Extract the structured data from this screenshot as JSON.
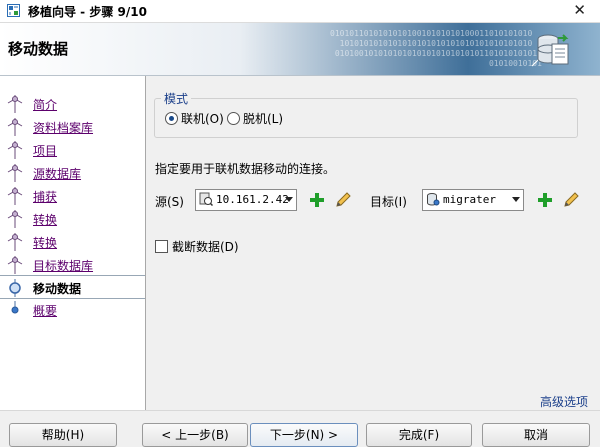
{
  "window": {
    "title": "移植向导 - 步骤 9/10",
    "close_glyph": "✕"
  },
  "header": {
    "title": "移动数据",
    "binary_text": "010101101010101010010101010100011010101010\n  1010101010101010101010101010101010101010\n 0101001010101010101010101010101101010101010\n                                 01010010101",
    "icon": "database-transfer-icon"
  },
  "sidebar": {
    "steps": [
      {
        "label": "简介",
        "state": "done"
      },
      {
        "label": "资料档案库",
        "state": "done"
      },
      {
        "label": "项目",
        "state": "done"
      },
      {
        "label": "源数据库",
        "state": "done"
      },
      {
        "label": "捕获",
        "state": "done"
      },
      {
        "label": "转换",
        "state": "done"
      },
      {
        "label": "转换",
        "state": "done"
      },
      {
        "label": "目标数据库",
        "state": "done"
      },
      {
        "label": "移动数据",
        "state": "active"
      },
      {
        "label": "概要",
        "state": "pending"
      }
    ]
  },
  "mode": {
    "legend": "模式",
    "online_label": "联机(O)",
    "offline_label": "脱机(L)",
    "selected": "online"
  },
  "connection": {
    "instruction": "指定要用于联机数据移动的连接。",
    "source_label": "源(S)",
    "source_value": "10.161.2.42",
    "target_label": "目标(I)",
    "target_value": "migrater"
  },
  "truncate": {
    "label": "截断数据(D)",
    "checked": false
  },
  "advanced_link": "高级选项",
  "buttons": {
    "help": "帮助(H)",
    "back": "< 上一步(B)",
    "next": "下一步(N) >",
    "finish": "完成(F)",
    "cancel": "取消"
  },
  "colors": {
    "link_visited": "#5c006c",
    "add_green": "#1f9e2a",
    "banner_blue": "#3f6f99"
  }
}
